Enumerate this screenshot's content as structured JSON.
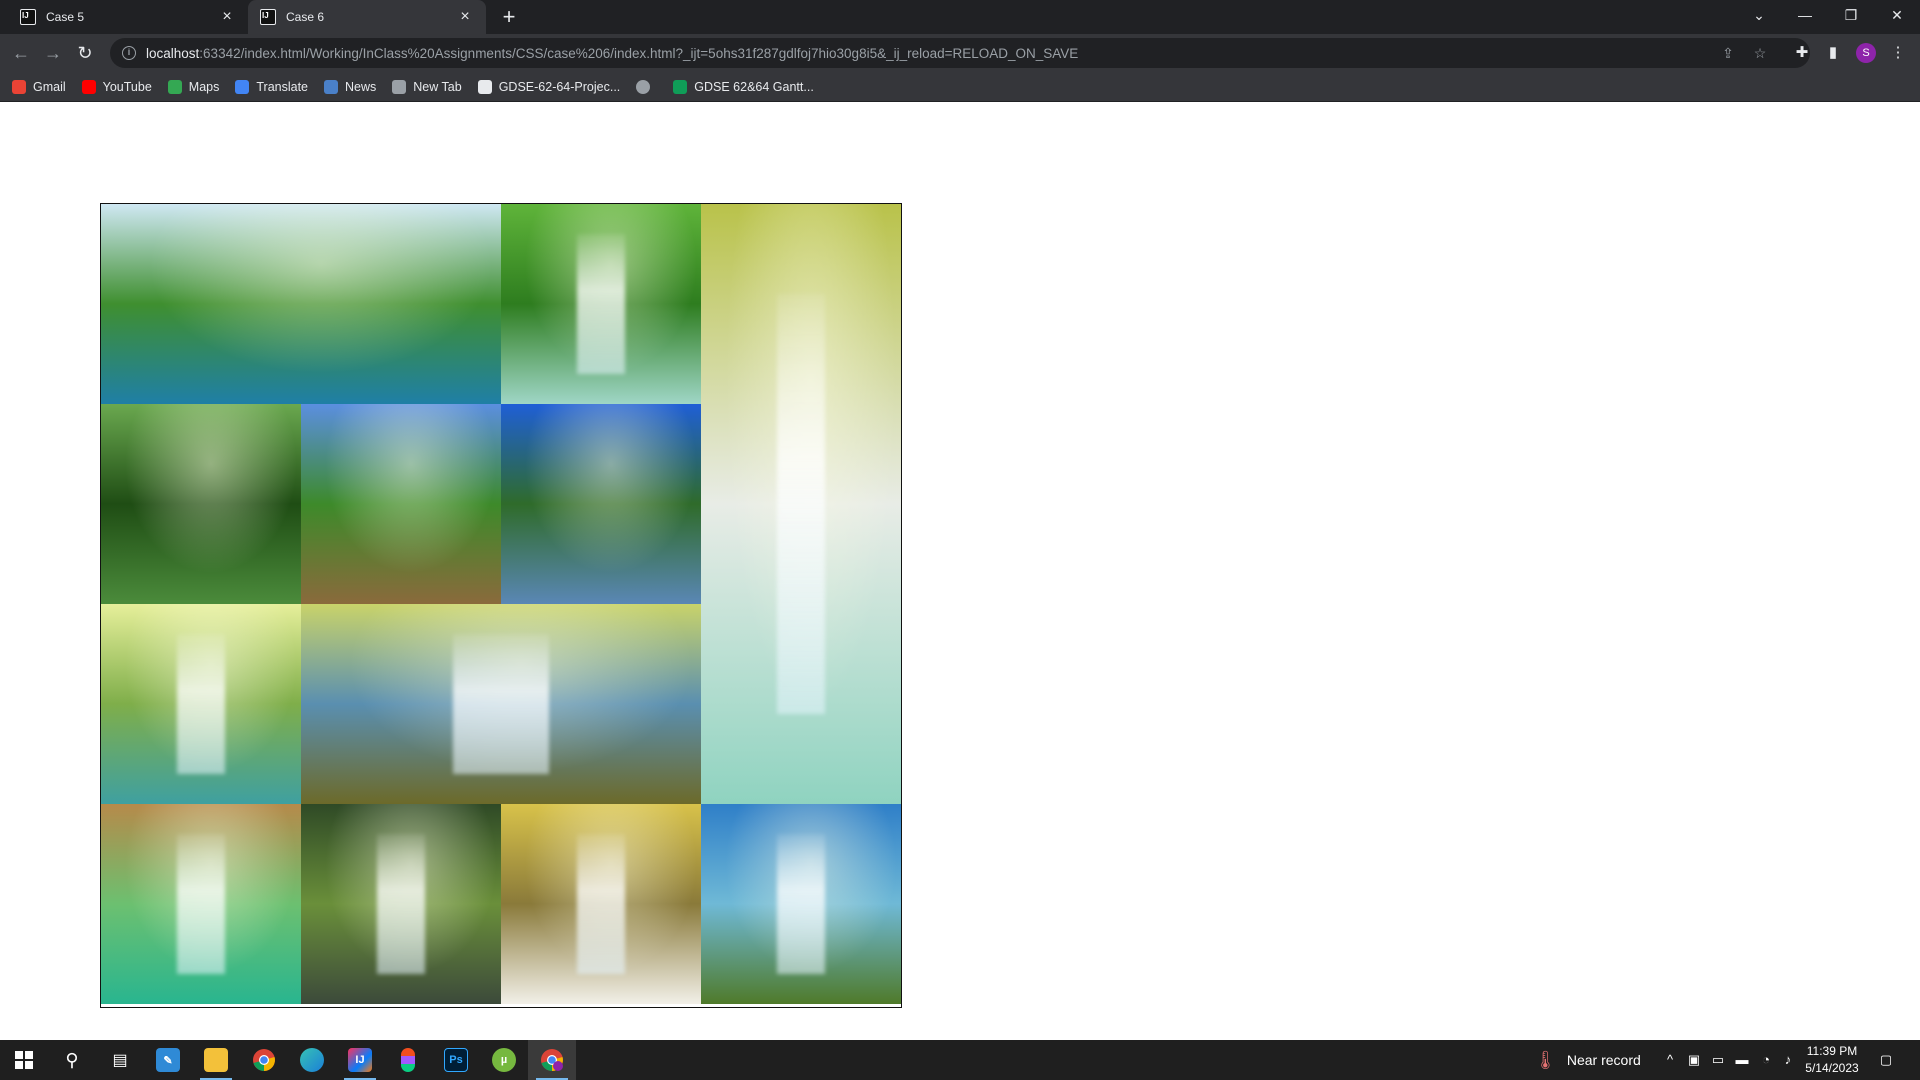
{
  "browser": {
    "tabs": [
      {
        "title": "Case 5",
        "active": false
      },
      {
        "title": "Case 6",
        "active": true
      }
    ],
    "url_host": "localhost",
    "url_rest": ":63342/index.html/Working/InClass%20Assignments/CSS/case%206/index.html?_ijt=5ohs31f287gdlfoj7hio30g8i5&_ij_reload=RELOAD_ON_SAVE",
    "profile_initial": "S",
    "bookmarks": [
      {
        "label": "Gmail",
        "color": "#ea4335"
      },
      {
        "label": "YouTube",
        "color": "#ff0000"
      },
      {
        "label": "Maps",
        "color": "#34a853"
      },
      {
        "label": "Translate",
        "color": "#4285f4"
      },
      {
        "label": "News",
        "color": "#4a80c8"
      },
      {
        "label": "New Tab",
        "color": "#9aa0a6"
      },
      {
        "label": "GDSE-62-64-Projec...",
        "color": "#e8eaed"
      },
      {
        "label": "",
        "color": "#9aa0a6"
      },
      {
        "label": "GDSE 62&64 Gantt...",
        "color": "#0f9d58"
      }
    ]
  },
  "gallery": {
    "tiles": [
      {
        "name": "tile-lake-forest",
        "sky": "#cfe8f3",
        "mid": "#3f8f2f",
        "low": "#1f7fa6"
      },
      {
        "name": "tile-green-cascade",
        "sky": "#5fb43a",
        "mid": "#2e7d1f",
        "low": "#9fd6c6"
      },
      {
        "name": "tile-tall-waterfall",
        "sky": "#b9c24a",
        "mid": "#e8ece6",
        "low": "#8fd3c0"
      },
      {
        "name": "tile-tree-reflection",
        "sky": "#6aa84f",
        "mid": "#1f4d14",
        "low": "#4b8b3b"
      },
      {
        "name": "tile-wooden-walkway",
        "sky": "#5b8fe0",
        "mid": "#3d8a2a",
        "low": "#8a6a3c"
      },
      {
        "name": "tile-mountain-lake",
        "sky": "#1f5fd6",
        "mid": "#2f6b2a",
        "low": "#5a87b5"
      },
      {
        "name": "tile-sunlit-falls",
        "sky": "#e6ef9a",
        "mid": "#7fae4a",
        "low": "#3fa0a0"
      },
      {
        "name": "tile-rapids",
        "sky": "#c9d36a",
        "mid": "#5a8fb0",
        "low": "#6c6a2a"
      },
      {
        "name": "tile-green-pool-falls",
        "sky": "#b68a4a",
        "mid": "#6cc070",
        "low": "#29b58f"
      },
      {
        "name": "tile-jungle-falls",
        "sky": "#2f4a26",
        "mid": "#6a8f3a",
        "low": "#3c4a3a"
      },
      {
        "name": "tile-golden-falls",
        "sky": "#d8c24a",
        "mid": "#8a7a3a",
        "low": "#f2f0e8"
      },
      {
        "name": "tile-blue-falls",
        "sky": "#2f7fc8",
        "mid": "#6fb9d6",
        "low": "#4f7a2a"
      }
    ]
  },
  "taskbar": {
    "weather": "Near record",
    "time": "11:39 PM",
    "date": "5/14/2023"
  }
}
